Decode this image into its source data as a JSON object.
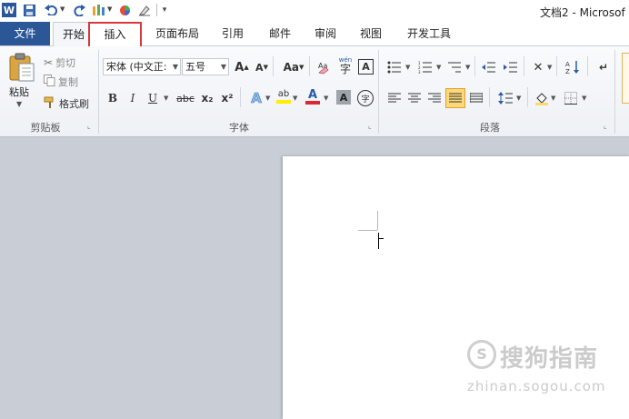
{
  "window": {
    "title": "文档2 - Microsof"
  },
  "quick_access": [
    "word-icon",
    "save-icon",
    "undo-icon",
    "redo-icon",
    "quick-tool-icon",
    "color-icon",
    "clear-icon",
    "customize-icon"
  ],
  "tabs": [
    {
      "label": "文件"
    },
    {
      "label": "开始"
    },
    {
      "label": "插入"
    },
    {
      "label": "页面布局"
    },
    {
      "label": "引用"
    },
    {
      "label": "邮件"
    },
    {
      "label": "审阅"
    },
    {
      "label": "视图"
    },
    {
      "label": "开发工具"
    }
  ],
  "clipboard": {
    "label": "剪贴板",
    "paste": "粘贴",
    "cut": "剪切",
    "copy": "复制",
    "format_painter": "格式刷"
  },
  "font": {
    "label": "字体",
    "name": "宋体 (中文正:",
    "size": "五号",
    "grow": "A",
    "shrink": "A",
    "case": "Aa",
    "bold": "B",
    "italic": "I",
    "underline": "U",
    "strike": "abc",
    "subscript": "x₂",
    "superscript": "x²",
    "highlight": "ab",
    "font_color": "A",
    "shade": "A",
    "enclose": "字",
    "phonetic": "wén",
    "border_char": "A"
  },
  "paragraph": {
    "label": "段落"
  },
  "colors": {
    "file_tab": "#2b5797",
    "highlight_box": "#d9363e",
    "font_color_bar": "#e0262e",
    "highlight_bar": "#ffee00"
  },
  "watermark": {
    "text": "搜狗指南",
    "sub": "zhinan.sogou.com"
  }
}
